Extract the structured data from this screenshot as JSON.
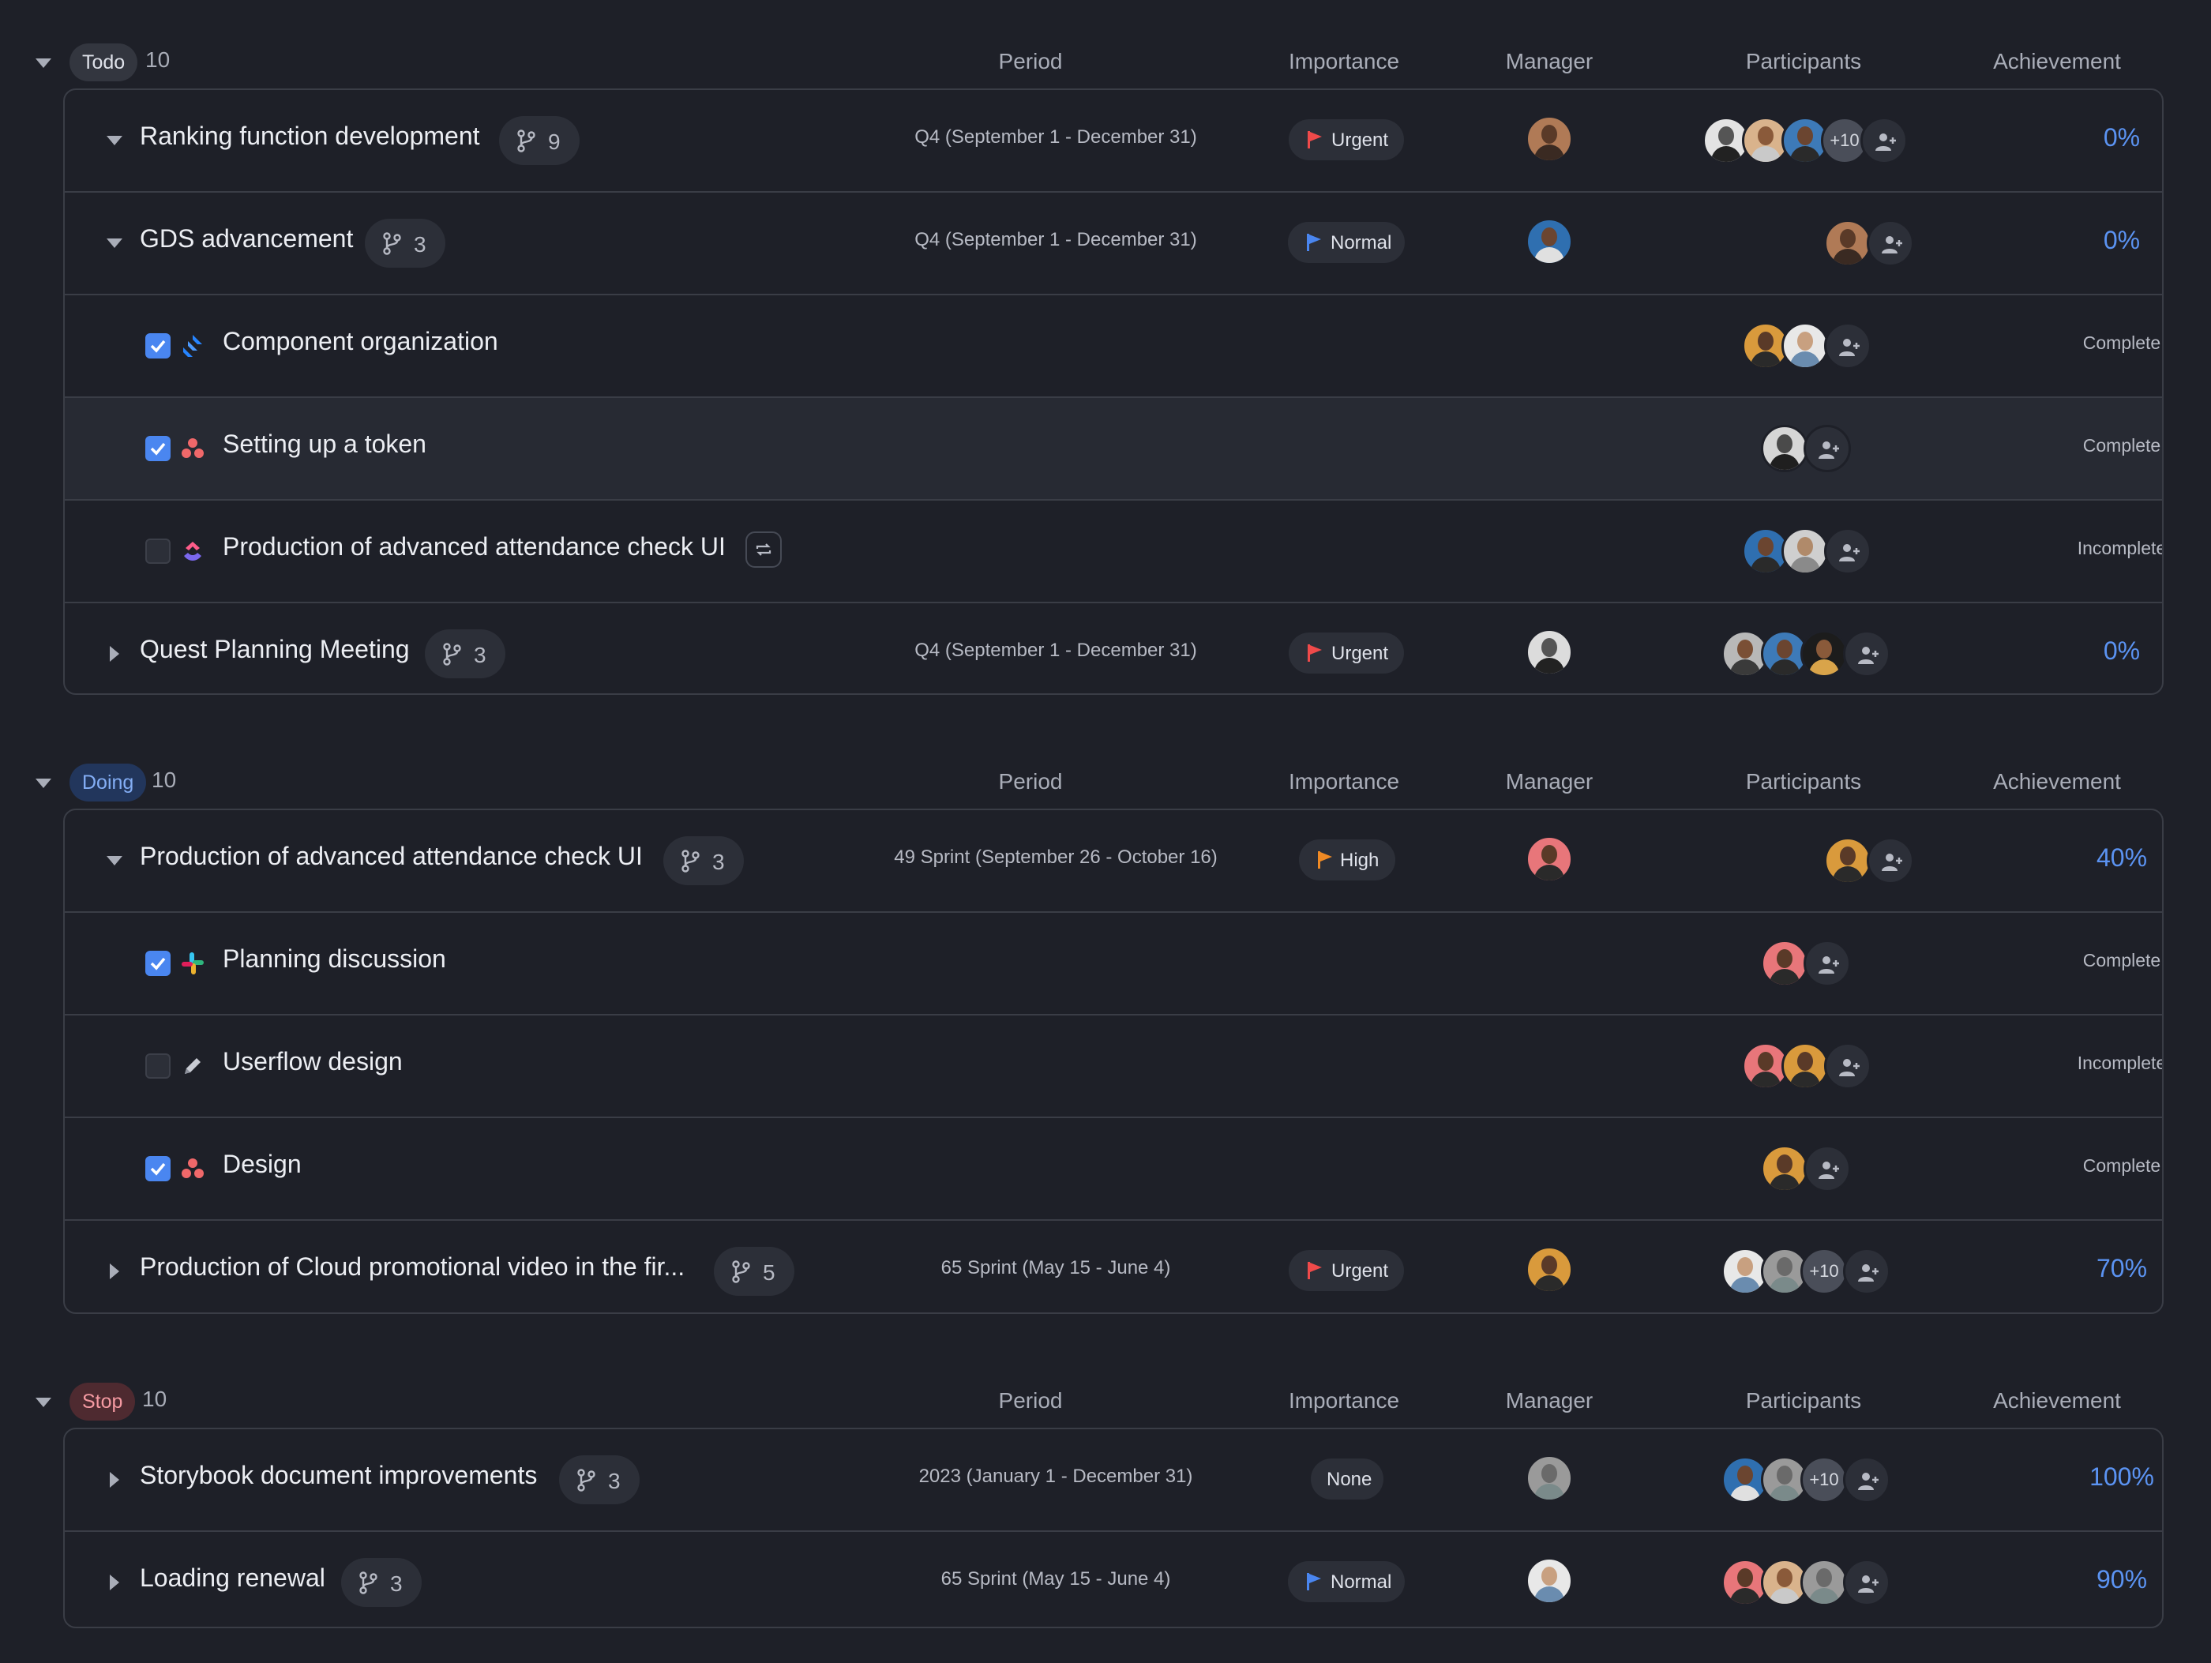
{
  "columns": {
    "period": "Period",
    "importance": "Importance",
    "manager": "Manager",
    "participants": "Participants",
    "achievement": "Achievement"
  },
  "groups": [
    {
      "label": "Todo",
      "count": "10",
      "rows": [
        {
          "type": "task",
          "title": "Ranking function development",
          "subtasks": "9",
          "period": "Q4 (September 1 - December 31)",
          "importance": "Urgent",
          "achievement": "0%",
          "extra_participants": "+10"
        },
        {
          "type": "task",
          "title": "GDS advancement",
          "subtasks": "3",
          "period": "Q4 (September 1 - December 31)",
          "importance": "Normal",
          "achievement": "0%"
        },
        {
          "type": "subtask",
          "title": "Component organization",
          "checked": true,
          "icon": "jira-icon",
          "status": "Complete"
        },
        {
          "type": "subtask",
          "title": "Setting up a token",
          "checked": true,
          "icon": "asana-icon",
          "status": "Complete"
        },
        {
          "type": "subtask",
          "title": "Production of advanced attendance check UI",
          "checked": false,
          "icon": "clickup-icon",
          "status": "Incomplete"
        },
        {
          "type": "task",
          "title": "Quest Planning Meeting",
          "subtasks": "3",
          "period": "Q4 (September 1 - December 31)",
          "importance": "Urgent",
          "achievement": "0%"
        }
      ]
    },
    {
      "label": "Doing",
      "count": "10",
      "rows": [
        {
          "type": "task",
          "title": "Production of advanced attendance check UI",
          "subtasks": "3",
          "period": "49 Sprint (September 26 - October 16)",
          "importance": "High",
          "achievement": "40%"
        },
        {
          "type": "subtask",
          "title": "Planning discussion",
          "checked": true,
          "icon": "slack-icon",
          "status": "Complete"
        },
        {
          "type": "subtask",
          "title": "Userflow design",
          "checked": false,
          "icon": "pencil-icon",
          "status": "Incomplete"
        },
        {
          "type": "subtask",
          "title": "Design",
          "checked": true,
          "icon": "asana-icon",
          "status": "Complete"
        },
        {
          "type": "task",
          "title": "Production of Cloud promotional video in the fir...",
          "subtasks": "5",
          "period": "65 Sprint (May 15 - June 4)",
          "importance": "Urgent",
          "achievement": "70%",
          "extra_participants": "+10"
        }
      ]
    },
    {
      "label": "Stop",
      "count": "10",
      "rows": [
        {
          "type": "task",
          "title": "Storybook document improvements",
          "subtasks": "3",
          "period": "2023 (January 1 - December 31)",
          "importance": "None",
          "achievement": "100%",
          "extra_participants": "+10"
        },
        {
          "type": "task",
          "title": "Loading renewal",
          "subtasks": "3",
          "period": "65 Sprint (May 15 - June 4)",
          "importance": "Normal",
          "achievement": "90%"
        }
      ]
    }
  ],
  "colors": {
    "background": "#1e2028",
    "accent_blue": "#5b93f2",
    "urgent_flag": "#ef4a4a",
    "high_flag": "#f08a24",
    "normal_flag": "#4a86f0"
  }
}
